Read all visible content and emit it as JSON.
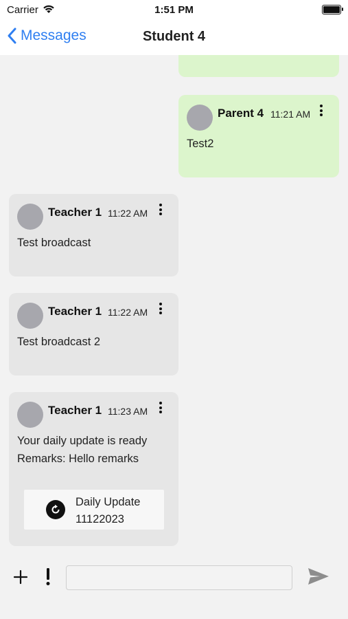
{
  "status_bar": {
    "carrier": "Carrier",
    "time": "1:51 PM"
  },
  "nav": {
    "back_label": "Messages",
    "title": "Student 4"
  },
  "messages": [
    {
      "sender": "Parent 4",
      "time": "11:21 AM",
      "lines": [
        "Test2"
      ],
      "own": true
    },
    {
      "sender": "Teacher 1",
      "time": "11:22 AM",
      "lines": [
        "Test broadcast"
      ],
      "own": false
    },
    {
      "sender": "Teacher 1",
      "time": "11:22 AM",
      "lines": [
        "Test broadcast 2"
      ],
      "own": false
    },
    {
      "sender": "Teacher 1",
      "time": "11:23 AM",
      "lines": [
        "Your daily update is ready",
        "Remarks: Hello remarks"
      ],
      "own": false,
      "attachment": {
        "title": "Daily Update",
        "subtitle": "11122023"
      }
    }
  ],
  "composer": {
    "value": "",
    "placeholder": ""
  },
  "icons": {
    "back": "chevron-left-icon",
    "add": "plus-icon",
    "alert": "exclamation-icon",
    "send": "send-icon",
    "more": "more-vertical-icon",
    "attachment": "refresh-icon"
  },
  "colors": {
    "accent": "#2f7ff1",
    "own_bubble": "#dcf5cc",
    "other_bubble": "#e6e6e6",
    "avatar": "#a7a7ad"
  }
}
